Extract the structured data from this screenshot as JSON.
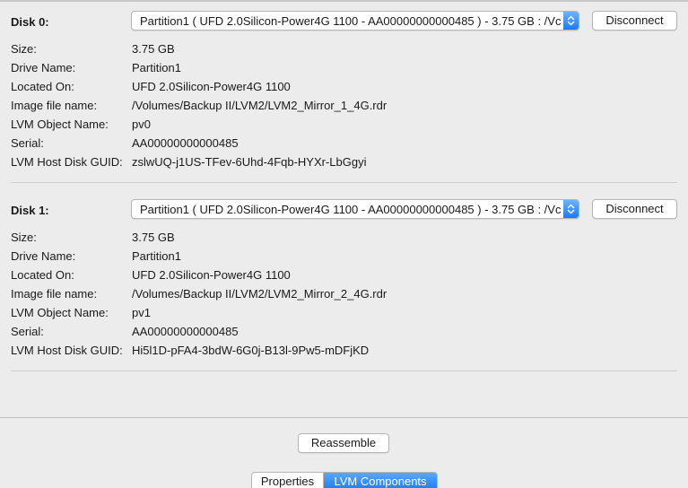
{
  "disks": [
    {
      "title": "Disk 0:",
      "selected_partition": "Partition1 ( UFD 2.0Silicon-Power4G 1100 - AA00000000000485 )  - 3.75 GB : /Vc",
      "disconnect_label": "Disconnect",
      "fields": [
        {
          "label": "Size:",
          "value": "3.75 GB"
        },
        {
          "label": "Drive Name:",
          "value": "Partition1"
        },
        {
          "label": "Located On:",
          "value": "UFD 2.0Silicon-Power4G 1100"
        },
        {
          "label": "Image file name:",
          "value": "/Volumes/Backup II/LVM2/LVM2_Mirror_1_4G.rdr"
        },
        {
          "label": "LVM Object Name:",
          "value": "pv0"
        },
        {
          "label": "Serial:",
          "value": "AA00000000000485"
        },
        {
          "label": "LVM Host Disk GUID:",
          "value": "zslwUQ-j1US-TFev-6Uhd-4Fqb-HYXr-LbGgyi"
        }
      ]
    },
    {
      "title": "Disk 1:",
      "selected_partition": "Partition1 ( UFD 2.0Silicon-Power4G 1100 - AA00000000000485 )  - 3.75 GB : /Vc",
      "disconnect_label": "Disconnect",
      "fields": [
        {
          "label": "Size:",
          "value": "3.75 GB"
        },
        {
          "label": "Drive Name:",
          "value": "Partition1"
        },
        {
          "label": "Located On:",
          "value": "UFD 2.0Silicon-Power4G 1100"
        },
        {
          "label": "Image file name:",
          "value": "/Volumes/Backup II/LVM2/LVM2_Mirror_2_4G.rdr"
        },
        {
          "label": "LVM Object Name:",
          "value": "pv1"
        },
        {
          "label": "Serial:",
          "value": "AA00000000000485"
        },
        {
          "label": "LVM Host Disk GUID:",
          "value": "Hi5l1D-pFA4-3bdW-6G0j-B13l-9Pw5-mDFjKD"
        }
      ]
    }
  ],
  "reassemble_label": "Reassemble",
  "tabs": [
    {
      "label": "Properties",
      "selected": false
    },
    {
      "label": "LVM Components",
      "selected": true
    }
  ],
  "icons": {
    "popup_arrows": "up-down-chevron-icon"
  },
  "colors": {
    "accent": "#1b7bf3",
    "background": "#ececec"
  }
}
